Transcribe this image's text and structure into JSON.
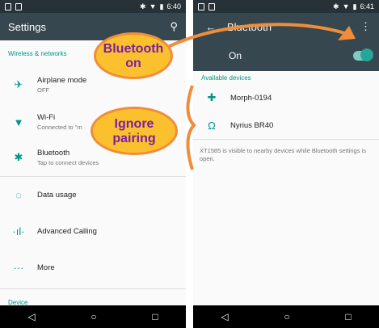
{
  "left": {
    "status": {
      "time": "6:40"
    },
    "toolbar": {
      "title": "Settings",
      "search_icon": "search-icon"
    },
    "section_wireless": "Wireless & networks",
    "items": [
      {
        "label": "Airplane mode",
        "sub": "OFF",
        "icon": "airplane-icon"
      },
      {
        "label": "Wi-Fi",
        "sub": "Connected to \"m",
        "icon": "wifi-icon"
      },
      {
        "label": "Bluetooth",
        "sub": "Tap to connect devices",
        "icon": "bluetooth-icon"
      },
      {
        "label": "Data usage",
        "sub": "",
        "icon": "data-usage-icon"
      },
      {
        "label": "Advanced Calling",
        "sub": "",
        "icon": "advanced-calling-icon"
      },
      {
        "label": "More",
        "sub": "",
        "icon": "more-icon"
      }
    ],
    "section_device": "Device"
  },
  "right": {
    "status": {
      "time": "6:41"
    },
    "toolbar": {
      "title": "Bluetooth",
      "back_icon": "back-arrow-icon",
      "menu_icon": "overflow-menu-icon"
    },
    "on_label": "On",
    "section_available": "Available devices",
    "devices": [
      {
        "name": "Morph-0194",
        "icon": "device-icon"
      },
      {
        "name": "Nyrius BR40",
        "icon": "headphones-icon"
      }
    ],
    "info": "XT1585 is visible to nearby devices while Bluetooth settings is open."
  },
  "callouts": {
    "bluetooth_on": "Bluetooth on",
    "ignore_pairing": "Ignore pairing"
  },
  "colors": {
    "accent": "#009688",
    "toolbar": "#37474f",
    "callout_fill": "#fbc02d",
    "callout_text": "#7b1fa2",
    "arrow": "#ef8d3a"
  }
}
